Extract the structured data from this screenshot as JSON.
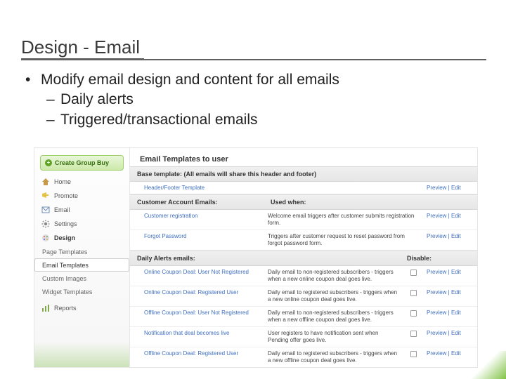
{
  "title": "Design - Email",
  "bullets": {
    "lvl1": "Modify email design and content for all emails",
    "lvl2a": "Daily alerts",
    "lvl2b": "Triggered/transactional emails"
  },
  "sidebar": {
    "create": "Create Group Buy",
    "items": [
      {
        "icon": "home-icon",
        "label": "Home"
      },
      {
        "icon": "promote-icon",
        "label": "Promote"
      },
      {
        "icon": "email-icon",
        "label": "Email"
      },
      {
        "icon": "settings-icon",
        "label": "Settings"
      },
      {
        "icon": "design-icon",
        "label": "Design",
        "bold": true
      }
    ],
    "sub": [
      "Page Templates",
      "Email Templates",
      "Custom Images",
      "Widget Templates"
    ],
    "active_sub": 1,
    "reports": "Reports"
  },
  "panel": {
    "heading": "Email Templates to user",
    "sec_base": {
      "label": "Base template: (All emails will share this header and footer)"
    },
    "row_base": {
      "name": "Header/Footer Template"
    },
    "sec_acct": {
      "c1": "Customer Account Emails:",
      "c2": "Used when:"
    },
    "rows_acct": [
      {
        "name": "Customer registration",
        "desc": "Welcome email triggers after customer submits registration form."
      },
      {
        "name": "Forgot Password",
        "desc": "Triggers after customer request to reset password from forgot password form."
      }
    ],
    "sec_daily": {
      "c1": "Daily Alerts emails:",
      "c3": "Disable:"
    },
    "rows_daily": [
      {
        "name": "Online Coupon Deal: User Not Registered",
        "desc": "Daily email to non-registered subscribers - triggers when a new online coupon deal goes live."
      },
      {
        "name": "Online Coupon Deal: Registered User",
        "desc": "Daily email to registered subscribers - triggers when a new online coupon deal goes live."
      },
      {
        "name": "Offline Coupon Deal: User Not Registered",
        "desc": "Daily email to non-registered subscribers - triggers when a new offline coupon deal goes live."
      },
      {
        "name": "Notification that deal becomes live",
        "desc": "User registers to have notification sent when Pending offer goes live."
      },
      {
        "name": "Offline Coupon Deal: Registered User",
        "desc": "Daily email to registered subscribers - triggers when a new offline coupon deal goes live."
      }
    ],
    "actions": {
      "preview": "Preview",
      "edit": "Edit",
      "sep": " | "
    }
  }
}
